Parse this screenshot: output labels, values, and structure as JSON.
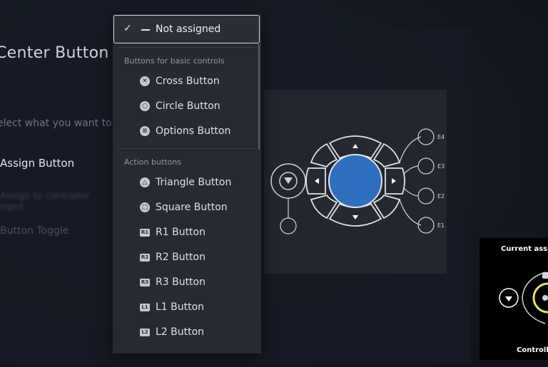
{
  "page": {
    "title": "Center Button",
    "instruction": "elect what you want to a",
    "options": {
      "assign": "Assign Button",
      "blurred": "Assign to controller input",
      "toggle": "Button Toggle"
    }
  },
  "dropdown": {
    "selected_label": "Not assigned",
    "check_icon": "checkmark-icon",
    "sections": [
      {
        "header": "Buttons for basic controls",
        "items": [
          {
            "label": "Cross Button",
            "icon": "cross-icon"
          },
          {
            "label": "Circle Button",
            "icon": "circle-icon"
          },
          {
            "label": "Options Button",
            "icon": "options-icon"
          }
        ]
      },
      {
        "header": "Action buttons",
        "items": [
          {
            "label": "Triangle Button",
            "icon": "triangle-icon"
          },
          {
            "label": "Square Button",
            "icon": "square-icon"
          },
          {
            "label": "R1 Button",
            "icon": "r1-icon",
            "glyph": "R1"
          },
          {
            "label": "R2 Button",
            "icon": "r2-icon",
            "glyph": "R2"
          },
          {
            "label": "R3 Button",
            "icon": "r3-icon",
            "glyph": "R3"
          },
          {
            "label": "L1 Button",
            "icon": "l1-icon",
            "glyph": "L1"
          },
          {
            "label": "L2 Button",
            "icon": "l2-icon",
            "glyph": "L2"
          }
        ]
      }
    ]
  },
  "controller": {
    "expansion_labels": [
      "E4",
      "E3",
      "E2",
      "E1"
    ],
    "center_color": "#2f6fc0"
  },
  "assign_card": {
    "title": "Current assig",
    "footer": "Controlle"
  },
  "colors": {
    "background": "#141922",
    "dropdown": "#262a32",
    "accent_blue": "#2f6fc0",
    "highlight_yellow": "#e8e26a"
  }
}
